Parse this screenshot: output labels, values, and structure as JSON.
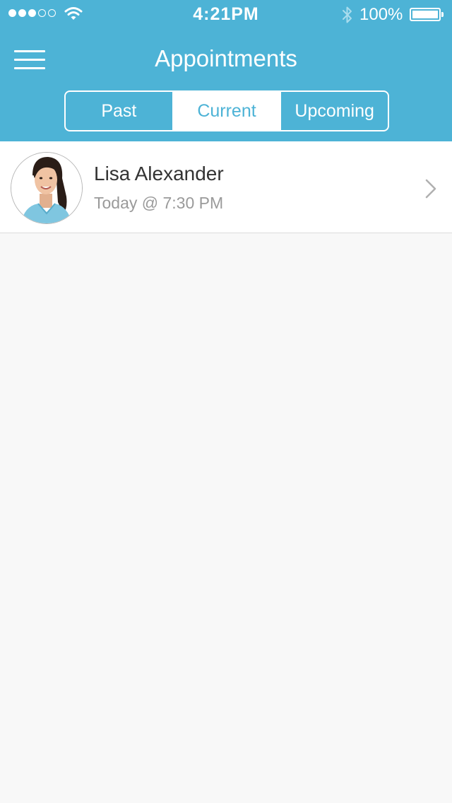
{
  "status_bar": {
    "time": "4:21PM",
    "battery_percent": "100%",
    "signal_bars_filled": 3,
    "signal_bars_total": 5,
    "icons": [
      "signal-dots-icon",
      "wifi-icon",
      "bluetooth-icon",
      "battery-icon"
    ]
  },
  "nav": {
    "title": "Appointments",
    "menu_icon": "hamburger-menu-icon"
  },
  "segments": {
    "items": [
      "Past",
      "Current",
      "Upcoming"
    ],
    "selected": "Current"
  },
  "appointments": [
    {
      "name": "Lisa Alexander",
      "time": "Today @ 7:30 PM",
      "avatar_icon": "avatar-photo",
      "disclosure_icon": "chevron-right-icon"
    }
  ],
  "colors": {
    "accent": "#4db3d6",
    "background": "#f8f8f8",
    "row_background": "#ffffff",
    "name_text": "#333333",
    "secondary_text": "#9a9a9a",
    "chevron": "#b0b0b0"
  }
}
